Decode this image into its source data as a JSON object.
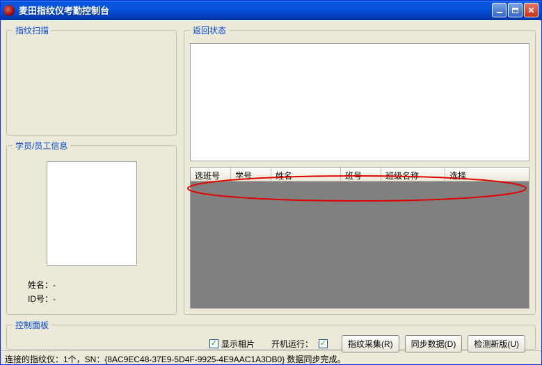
{
  "window": {
    "title": "麦田指纹仪考勤控制台"
  },
  "panels": {
    "fingerprint_scan": "指纹扫描",
    "employee_info": "学员/员工信息",
    "return_status": "返回状态",
    "control_panel": "控制面板"
  },
  "employee": {
    "name_label": "姓名：",
    "name_value": "-",
    "id_label": "ID号：",
    "id_value": "-"
  },
  "grid": {
    "columns": [
      "选班号",
      "学号",
      "姓名",
      "班号",
      "班级名称",
      "选择"
    ],
    "rows": []
  },
  "controls": {
    "show_photo_label": "显示相片",
    "show_photo_checked": true,
    "boot_run_label": "开机运行：",
    "boot_run_checked": true,
    "btn_collect": "指纹采集(R)",
    "btn_sync": "同步数据(D)",
    "btn_update": "检测新版(U)"
  },
  "statusbar": {
    "text": "连接的指纹仪：1个，SN：{8AC9EC48-37E9-5D4F-9925-4E9AAC1A3DB0} 数据同步完成。"
  }
}
